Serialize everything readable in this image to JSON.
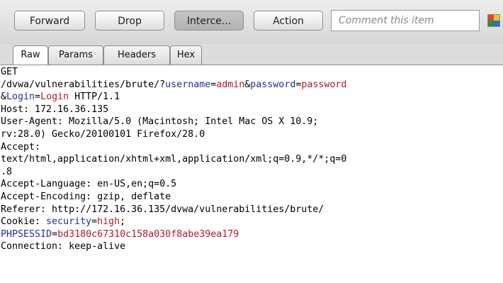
{
  "toolbar": {
    "forward_label": "Forward",
    "drop_label": "Drop",
    "intercept_label": "Interce...",
    "action_label": "Action",
    "comment_placeholder": "Comment this item"
  },
  "tabs": [
    "Raw",
    "Params",
    "Headers",
    "Hex"
  ],
  "request": {
    "line1": "GET",
    "line2_path": "/dvwa/vulnerabilities/brute/?",
    "p_username_key": "username",
    "p_username_val": "admin",
    "p_password_key": "password",
    "p_password_val": "password",
    "p_login_key": "Login",
    "p_login_val": "Login",
    "http_version": " HTTP/1.1",
    "host": "Host: 172.16.36.135",
    "ua1": "User-Agent: Mozilla/5.0 (Macintosh; Intel Mac OS X 10.9;",
    "ua2": "rv:28.0) Gecko/20100101 Firefox/28.0",
    "accept_label": "Accept:",
    "accept_val1": "text/html,application/xhtml+xml,application/xml;q=0.9,*/*;q=0",
    "accept_val2": ".8",
    "accept_language": "Accept-Language: en-US,en;q=0.5",
    "accept_encoding": "Accept-Encoding: gzip, deflate",
    "referer": "Referer: http://172.16.36.135/dvwa/vulnerabilities/brute/",
    "cookie_label": "Cookie: ",
    "cookie_security_key": "security",
    "cookie_security_val": "high",
    "cookie_phpsessid_key": "PHPSESSID",
    "cookie_phpsessid_val": "bd3180c67310c158a030f8abe39ea179",
    "connection": "Connection: keep-alive"
  },
  "colors": {
    "param_name": "#1f2f9e",
    "param_value": "#b0192e",
    "toolbar_bg": "#dcdcdc"
  }
}
